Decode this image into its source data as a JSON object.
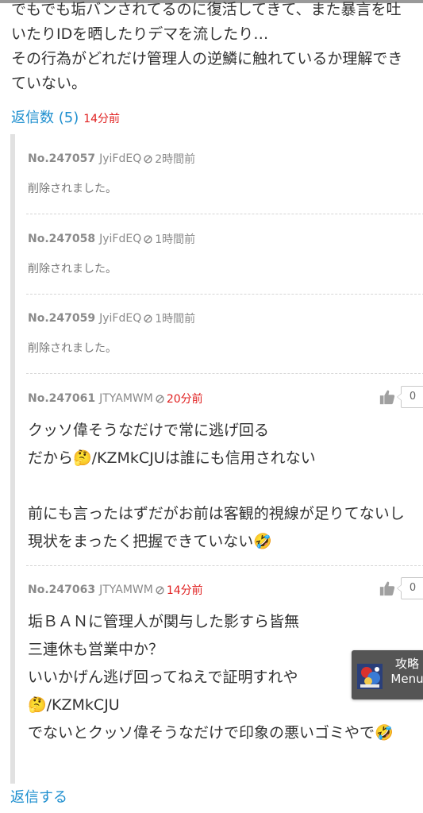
{
  "post": {
    "body": "でもでも垢バンされてるのに復活してきて、また暴言を吐いたりIDを晒したりデマを流したり…\nその行為がどれだけ管理人の逆鱗に触れているか理解できていない。",
    "reply_count_label": "返信数 (5)",
    "reply_count_time": "14分前"
  },
  "replies": [
    {
      "number": "No.247057",
      "user_id": "JyiFdEQ",
      "time": "2時間前",
      "deleted_text": "削除されました。"
    },
    {
      "number": "No.247058",
      "user_id": "JyiFdEQ",
      "time": "1時間前",
      "deleted_text": "削除されました。"
    },
    {
      "number": "No.247059",
      "user_id": "JyiFdEQ",
      "time": "1時間前",
      "deleted_text": "削除されました。"
    },
    {
      "number": "No.247061",
      "user_id": "JTYAMWM",
      "time": "20分前",
      "body": "クッソ偉そうなだけで常に逃げ回る\nだから🤔/KZMkCJUは誰にも信用されない\n\n前にも言ったはずだがお前は客観的視線が足りてないし現状をまったく把握できていない🤣",
      "likes": "0"
    },
    {
      "number": "No.247063",
      "user_id": "JTYAMWM",
      "time": "14分前",
      "body": "垢ＢＡＮに管理人が関与した影すら皆無\n三連休も営業中か？\nいいかげん逃げ回ってねえで証明すれや\n🤔/KZMkCJU\nでないとクッソ偉そうなだけで印象の悪いゴミやで🤣",
      "likes": "0"
    }
  ],
  "reply_action_label": "返信する",
  "float_menu": {
    "line1": "攻略",
    "line2": "Menu"
  },
  "colors": {
    "link": "#1e8fcf",
    "recent_time": "#e02020",
    "muted": "#8a8a8a",
    "thread_bar": "#e1e1e1"
  },
  "icons": {
    "block": "block-icon",
    "like": "thumbs-up-icon"
  }
}
